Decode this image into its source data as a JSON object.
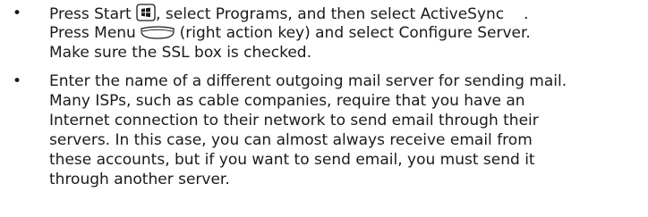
{
  "instructions": [
    {
      "bullet": "•",
      "line1_pre": "Press Start ",
      "line1_post": ", select Programs, and then select ActiveSync",
      "line1_tail": ".",
      "line2_pre": "Press Menu ",
      "line2_post": " (right action key) and select Configure Server.",
      "line3": "Make sure the SSL box is checked.",
      "icons": [
        "windows-start-icon",
        "menu-key-icon"
      ]
    },
    {
      "bullet": "•",
      "lines": [
        "Enter the name of a different outgoing mail server for sending mail.",
        "Many ISPs, such as cable companies, require that you have an",
        "Internet connection to their network to send email through their",
        "servers. In this case, you can almost always receive email from",
        "these accounts, but if you want to send email, you must send it",
        "through another server."
      ]
    }
  ]
}
